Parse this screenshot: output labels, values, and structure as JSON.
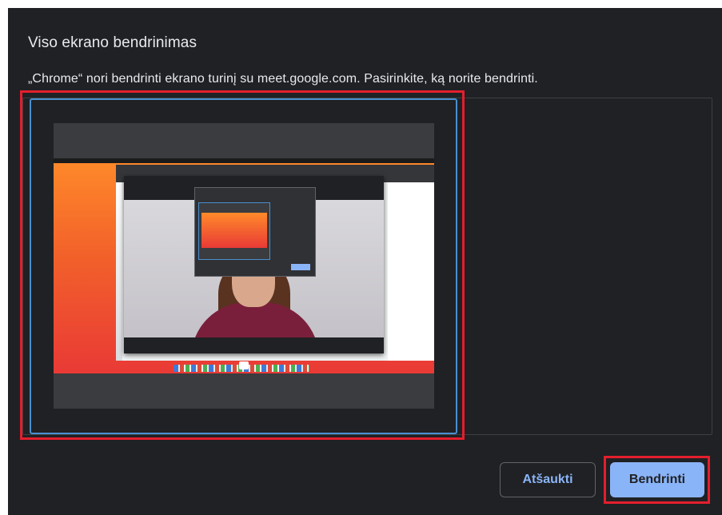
{
  "dialog": {
    "title": "Viso ekrano bendrinimas",
    "subtitle": "„Chrome“ nori bendrinti ekrano turinį su meet.google.com. Pasirinkite, ką norite bendrinti.",
    "sources": [
      {
        "type": "entire-screen",
        "selected": true
      }
    ],
    "buttons": {
      "cancel": "Atšaukti",
      "share": "Bendrinti"
    }
  },
  "colors": {
    "background": "#202124",
    "text": "#e8eaed",
    "accent": "#8ab4f8",
    "selection_border": "#4a8fcf",
    "annotation_red": "#e41e2d"
  }
}
